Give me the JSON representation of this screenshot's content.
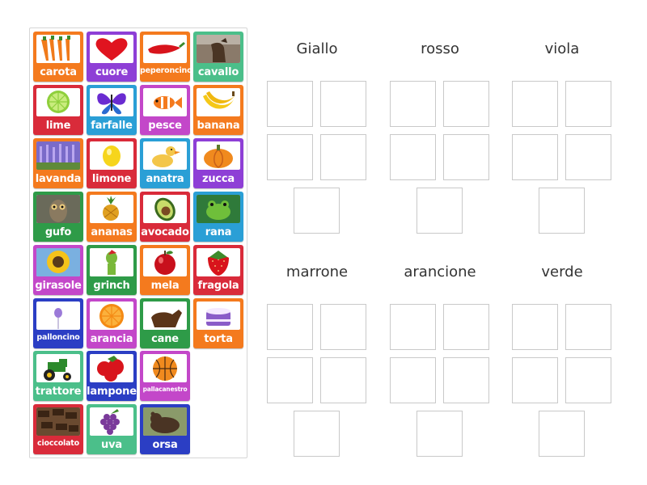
{
  "colors": {
    "blue": "#2a9fd6",
    "purple": "#8e3fd6",
    "orange": "#f47a1e",
    "green": "#4bbf8a",
    "red": "#d92b3a",
    "violet": "#c347c9",
    "darkgreen": "#2e9b48",
    "navy": "#2b3ec4"
  },
  "tiles": [
    {
      "label": "carota",
      "color": "orange",
      "icon": "carrot-icon"
    },
    {
      "label": "cuore",
      "color": "purple",
      "icon": "heart-icon"
    },
    {
      "label": "peperoncino",
      "color": "orange",
      "icon": "chili-pepper-icon",
      "size": "s"
    },
    {
      "label": "cavallo",
      "color": "green",
      "icon": "horse-icon"
    },
    {
      "label": "lime",
      "color": "red",
      "icon": "lime-icon"
    },
    {
      "label": "farfalle",
      "color": "blue",
      "icon": "butterfly-icon"
    },
    {
      "label": "pesce",
      "color": "violet",
      "icon": "fish-icon"
    },
    {
      "label": "banana",
      "color": "orange",
      "icon": "banana-icon"
    },
    {
      "label": "lavanda",
      "color": "orange",
      "icon": "lavender-icon"
    },
    {
      "label": "limone",
      "color": "red",
      "icon": "lemon-icon"
    },
    {
      "label": "anatra",
      "color": "blue",
      "icon": "duck-icon"
    },
    {
      "label": "zucca",
      "color": "purple",
      "icon": "pumpkin-icon"
    },
    {
      "label": "gufo",
      "color": "darkgreen",
      "icon": "owl-icon"
    },
    {
      "label": "ananas",
      "color": "orange",
      "icon": "pineapple-icon"
    },
    {
      "label": "avocado",
      "color": "red",
      "icon": "avocado-icon"
    },
    {
      "label": "rana",
      "color": "blue",
      "icon": "frog-icon"
    },
    {
      "label": "girasole",
      "color": "violet",
      "icon": "sunflower-icon"
    },
    {
      "label": "grinch",
      "color": "darkgreen",
      "icon": "grinch-icon"
    },
    {
      "label": "mela",
      "color": "orange",
      "icon": "apple-icon"
    },
    {
      "label": "fragola",
      "color": "red",
      "icon": "strawberry-icon"
    },
    {
      "label": "palloncino",
      "color": "navy",
      "icon": "balloon-icon",
      "size": "s"
    },
    {
      "label": "arancia",
      "color": "violet",
      "icon": "orange-fruit-icon"
    },
    {
      "label": "cane",
      "color": "darkgreen",
      "icon": "dog-icon"
    },
    {
      "label": "torta",
      "color": "orange",
      "icon": "cake-icon"
    },
    {
      "label": "trattore",
      "color": "green",
      "icon": "tractor-icon"
    },
    {
      "label": "lampone",
      "color": "navy",
      "icon": "raspberry-icon"
    },
    {
      "label": "pallacanestro",
      "color": "violet",
      "icon": "basketball-icon",
      "size": "xs"
    },
    {
      "label": "cioccolato",
      "color": "red",
      "icon": "chocolate-icon",
      "size": "s"
    },
    {
      "label": "uva",
      "color": "green",
      "icon": "grapes-icon"
    },
    {
      "label": "orsa",
      "color": "navy",
      "icon": "bear-icon"
    }
  ],
  "groups": [
    {
      "title": "Giallo"
    },
    {
      "title": "rosso"
    },
    {
      "title": "viola"
    },
    {
      "title": "marrone"
    },
    {
      "title": "arancione"
    },
    {
      "title": "verde"
    }
  ]
}
